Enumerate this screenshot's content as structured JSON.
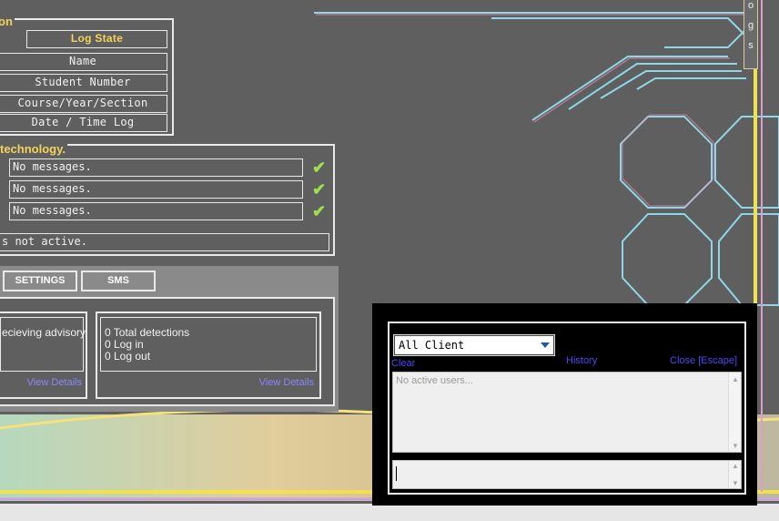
{
  "student_panel": {
    "heading_fragment": "on",
    "log_state": "Log State",
    "fields": [
      "Name",
      "Student Number",
      "Course/Year/Section",
      "Date / Time Log"
    ]
  },
  "technology_panel": {
    "heading_fragment": "technology.",
    "messages": [
      "No messages.",
      "No messages.",
      "No messages."
    ],
    "status": "s not active."
  },
  "tabs": {
    "settings": "SETTINGS",
    "sms": "SMS"
  },
  "left_card": {
    "text": "ecieving advisory",
    "link": "View Details"
  },
  "detections_card": {
    "lines": [
      "0 Total detections",
      "0 Log in",
      "0 Log out"
    ],
    "link": "View Details"
  },
  "logs_tab": {
    "label": "o g s"
  },
  "chat": {
    "client_select": "All Client",
    "clear": "Clear",
    "history": "History",
    "close": "Close [Escape]",
    "users_placeholder": "No active users..."
  },
  "colors": {
    "accent_yellow": "#f4d35a",
    "check_green": "#9de04c",
    "link_blue": "#4f46ff"
  }
}
